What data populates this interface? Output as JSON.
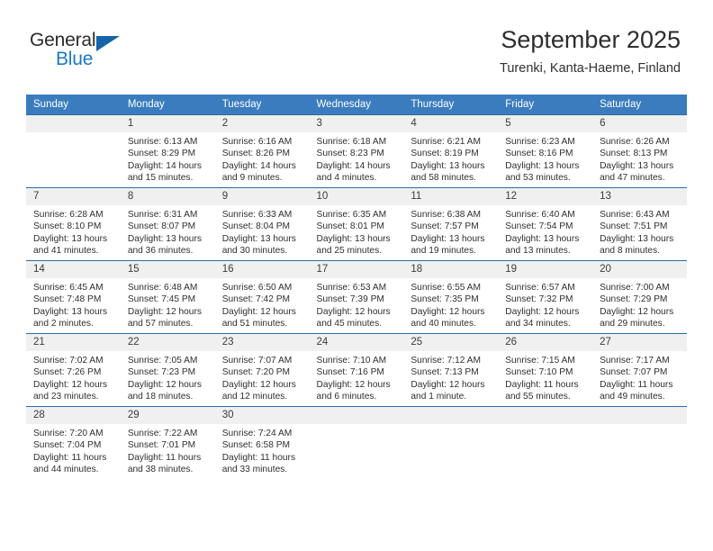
{
  "brand": {
    "name_part1": "General",
    "name_part2": "Blue",
    "colors": {
      "dark": "#2b2b2b",
      "blue": "#1a78c2",
      "triangle": "#1565a8"
    }
  },
  "header": {
    "title": "September 2025",
    "subtitle": "Turenki, Kanta-Haeme, Finland"
  },
  "calendar": {
    "accent_color": "#3a7cbe",
    "row_border_color": "#2d6da8",
    "daynum_background": "#f0f0f0",
    "weekday_headers": [
      "Sunday",
      "Monday",
      "Tuesday",
      "Wednesday",
      "Thursday",
      "Friday",
      "Saturday"
    ],
    "weeks": [
      [
        {
          "day": "",
          "empty": true,
          "sunrise": "",
          "sunset": "",
          "daylight_line1": "",
          "daylight_line2": ""
        },
        {
          "day": "1",
          "empty": false,
          "sunrise": "Sunrise: 6:13 AM",
          "sunset": "Sunset: 8:29 PM",
          "daylight_line1": "Daylight: 14 hours",
          "daylight_line2": "and 15 minutes."
        },
        {
          "day": "2",
          "empty": false,
          "sunrise": "Sunrise: 6:16 AM",
          "sunset": "Sunset: 8:26 PM",
          "daylight_line1": "Daylight: 14 hours",
          "daylight_line2": "and 9 minutes."
        },
        {
          "day": "3",
          "empty": false,
          "sunrise": "Sunrise: 6:18 AM",
          "sunset": "Sunset: 8:23 PM",
          "daylight_line1": "Daylight: 14 hours",
          "daylight_line2": "and 4 minutes."
        },
        {
          "day": "4",
          "empty": false,
          "sunrise": "Sunrise: 6:21 AM",
          "sunset": "Sunset: 8:19 PM",
          "daylight_line1": "Daylight: 13 hours",
          "daylight_line2": "and 58 minutes."
        },
        {
          "day": "5",
          "empty": false,
          "sunrise": "Sunrise: 6:23 AM",
          "sunset": "Sunset: 8:16 PM",
          "daylight_line1": "Daylight: 13 hours",
          "daylight_line2": "and 53 minutes."
        },
        {
          "day": "6",
          "empty": false,
          "sunrise": "Sunrise: 6:26 AM",
          "sunset": "Sunset: 8:13 PM",
          "daylight_line1": "Daylight: 13 hours",
          "daylight_line2": "and 47 minutes."
        }
      ],
      [
        {
          "day": "7",
          "empty": false,
          "sunrise": "Sunrise: 6:28 AM",
          "sunset": "Sunset: 8:10 PM",
          "daylight_line1": "Daylight: 13 hours",
          "daylight_line2": "and 41 minutes."
        },
        {
          "day": "8",
          "empty": false,
          "sunrise": "Sunrise: 6:31 AM",
          "sunset": "Sunset: 8:07 PM",
          "daylight_line1": "Daylight: 13 hours",
          "daylight_line2": "and 36 minutes."
        },
        {
          "day": "9",
          "empty": false,
          "sunrise": "Sunrise: 6:33 AM",
          "sunset": "Sunset: 8:04 PM",
          "daylight_line1": "Daylight: 13 hours",
          "daylight_line2": "and 30 minutes."
        },
        {
          "day": "10",
          "empty": false,
          "sunrise": "Sunrise: 6:35 AM",
          "sunset": "Sunset: 8:01 PM",
          "daylight_line1": "Daylight: 13 hours",
          "daylight_line2": "and 25 minutes."
        },
        {
          "day": "11",
          "empty": false,
          "sunrise": "Sunrise: 6:38 AM",
          "sunset": "Sunset: 7:57 PM",
          "daylight_line1": "Daylight: 13 hours",
          "daylight_line2": "and 19 minutes."
        },
        {
          "day": "12",
          "empty": false,
          "sunrise": "Sunrise: 6:40 AM",
          "sunset": "Sunset: 7:54 PM",
          "daylight_line1": "Daylight: 13 hours",
          "daylight_line2": "and 13 minutes."
        },
        {
          "day": "13",
          "empty": false,
          "sunrise": "Sunrise: 6:43 AM",
          "sunset": "Sunset: 7:51 PM",
          "daylight_line1": "Daylight: 13 hours",
          "daylight_line2": "and 8 minutes."
        }
      ],
      [
        {
          "day": "14",
          "empty": false,
          "sunrise": "Sunrise: 6:45 AM",
          "sunset": "Sunset: 7:48 PM",
          "daylight_line1": "Daylight: 13 hours",
          "daylight_line2": "and 2 minutes."
        },
        {
          "day": "15",
          "empty": false,
          "sunrise": "Sunrise: 6:48 AM",
          "sunset": "Sunset: 7:45 PM",
          "daylight_line1": "Daylight: 12 hours",
          "daylight_line2": "and 57 minutes."
        },
        {
          "day": "16",
          "empty": false,
          "sunrise": "Sunrise: 6:50 AM",
          "sunset": "Sunset: 7:42 PM",
          "daylight_line1": "Daylight: 12 hours",
          "daylight_line2": "and 51 minutes."
        },
        {
          "day": "17",
          "empty": false,
          "sunrise": "Sunrise: 6:53 AM",
          "sunset": "Sunset: 7:39 PM",
          "daylight_line1": "Daylight: 12 hours",
          "daylight_line2": "and 45 minutes."
        },
        {
          "day": "18",
          "empty": false,
          "sunrise": "Sunrise: 6:55 AM",
          "sunset": "Sunset: 7:35 PM",
          "daylight_line1": "Daylight: 12 hours",
          "daylight_line2": "and 40 minutes."
        },
        {
          "day": "19",
          "empty": false,
          "sunrise": "Sunrise: 6:57 AM",
          "sunset": "Sunset: 7:32 PM",
          "daylight_line1": "Daylight: 12 hours",
          "daylight_line2": "and 34 minutes."
        },
        {
          "day": "20",
          "empty": false,
          "sunrise": "Sunrise: 7:00 AM",
          "sunset": "Sunset: 7:29 PM",
          "daylight_line1": "Daylight: 12 hours",
          "daylight_line2": "and 29 minutes."
        }
      ],
      [
        {
          "day": "21",
          "empty": false,
          "sunrise": "Sunrise: 7:02 AM",
          "sunset": "Sunset: 7:26 PM",
          "daylight_line1": "Daylight: 12 hours",
          "daylight_line2": "and 23 minutes."
        },
        {
          "day": "22",
          "empty": false,
          "sunrise": "Sunrise: 7:05 AM",
          "sunset": "Sunset: 7:23 PM",
          "daylight_line1": "Daylight: 12 hours",
          "daylight_line2": "and 18 minutes."
        },
        {
          "day": "23",
          "empty": false,
          "sunrise": "Sunrise: 7:07 AM",
          "sunset": "Sunset: 7:20 PM",
          "daylight_line1": "Daylight: 12 hours",
          "daylight_line2": "and 12 minutes."
        },
        {
          "day": "24",
          "empty": false,
          "sunrise": "Sunrise: 7:10 AM",
          "sunset": "Sunset: 7:16 PM",
          "daylight_line1": "Daylight: 12 hours",
          "daylight_line2": "and 6 minutes."
        },
        {
          "day": "25",
          "empty": false,
          "sunrise": "Sunrise: 7:12 AM",
          "sunset": "Sunset: 7:13 PM",
          "daylight_line1": "Daylight: 12 hours",
          "daylight_line2": "and 1 minute."
        },
        {
          "day": "26",
          "empty": false,
          "sunrise": "Sunrise: 7:15 AM",
          "sunset": "Sunset: 7:10 PM",
          "daylight_line1": "Daylight: 11 hours",
          "daylight_line2": "and 55 minutes."
        },
        {
          "day": "27",
          "empty": false,
          "sunrise": "Sunrise: 7:17 AM",
          "sunset": "Sunset: 7:07 PM",
          "daylight_line1": "Daylight: 11 hours",
          "daylight_line2": "and 49 minutes."
        }
      ],
      [
        {
          "day": "28",
          "empty": false,
          "sunrise": "Sunrise: 7:20 AM",
          "sunset": "Sunset: 7:04 PM",
          "daylight_line1": "Daylight: 11 hours",
          "daylight_line2": "and 44 minutes."
        },
        {
          "day": "29",
          "empty": false,
          "sunrise": "Sunrise: 7:22 AM",
          "sunset": "Sunset: 7:01 PM",
          "daylight_line1": "Daylight: 11 hours",
          "daylight_line2": "and 38 minutes."
        },
        {
          "day": "30",
          "empty": false,
          "sunrise": "Sunrise: 7:24 AM",
          "sunset": "Sunset: 6:58 PM",
          "daylight_line1": "Daylight: 11 hours",
          "daylight_line2": "and 33 minutes."
        },
        {
          "day": "",
          "empty": true,
          "sunrise": "",
          "sunset": "",
          "daylight_line1": "",
          "daylight_line2": ""
        },
        {
          "day": "",
          "empty": true,
          "sunrise": "",
          "sunset": "",
          "daylight_line1": "",
          "daylight_line2": ""
        },
        {
          "day": "",
          "empty": true,
          "sunrise": "",
          "sunset": "",
          "daylight_line1": "",
          "daylight_line2": ""
        },
        {
          "day": "",
          "empty": true,
          "sunrise": "",
          "sunset": "",
          "daylight_line1": "",
          "daylight_line2": ""
        }
      ]
    ]
  }
}
